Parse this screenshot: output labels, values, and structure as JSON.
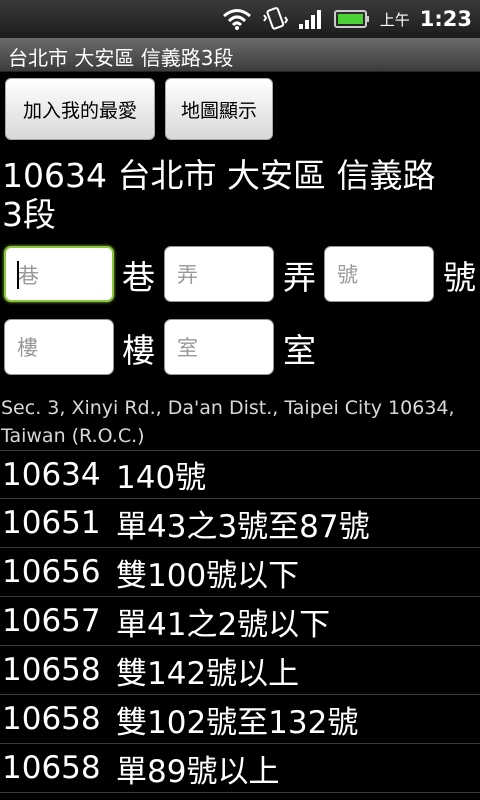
{
  "status_bar": {
    "ampm": "上午",
    "time": "1:23",
    "icons": [
      "wifi-icon",
      "vibrate-icon",
      "signal-icon",
      "battery-icon"
    ]
  },
  "title_bar": {
    "title": "台北市 大安區 信義路3段"
  },
  "buttons": {
    "add_favorite": "加入我的最愛",
    "map_view": "地圖顯示"
  },
  "heading": "10634 台北市 大安區 信義路3段",
  "address_form": {
    "lane": {
      "placeholder": "巷",
      "suffix": "巷"
    },
    "alley": {
      "placeholder": "弄",
      "suffix": "弄"
    },
    "number": {
      "placeholder": "號",
      "suffix": "號"
    },
    "floor": {
      "placeholder": "樓",
      "suffix": "樓"
    },
    "room": {
      "placeholder": "室",
      "suffix": "室"
    }
  },
  "english_address": "Sec. 3, Xinyi Rd., Da'an Dist., Taipei City 10634, Taiwan (R.O.C.)",
  "zip_list": [
    {
      "zip": "10634",
      "range": "140號"
    },
    {
      "zip": "10651",
      "range": "單43之3號至87號"
    },
    {
      "zip": "10656",
      "range": "雙100號以下"
    },
    {
      "zip": "10657",
      "range": "單41之2號以下"
    },
    {
      "zip": "10658",
      "range": "雙142號以上"
    },
    {
      "zip": "10658",
      "range": "雙102號至132號"
    },
    {
      "zip": "10658",
      "range": "單89號以上"
    }
  ]
}
